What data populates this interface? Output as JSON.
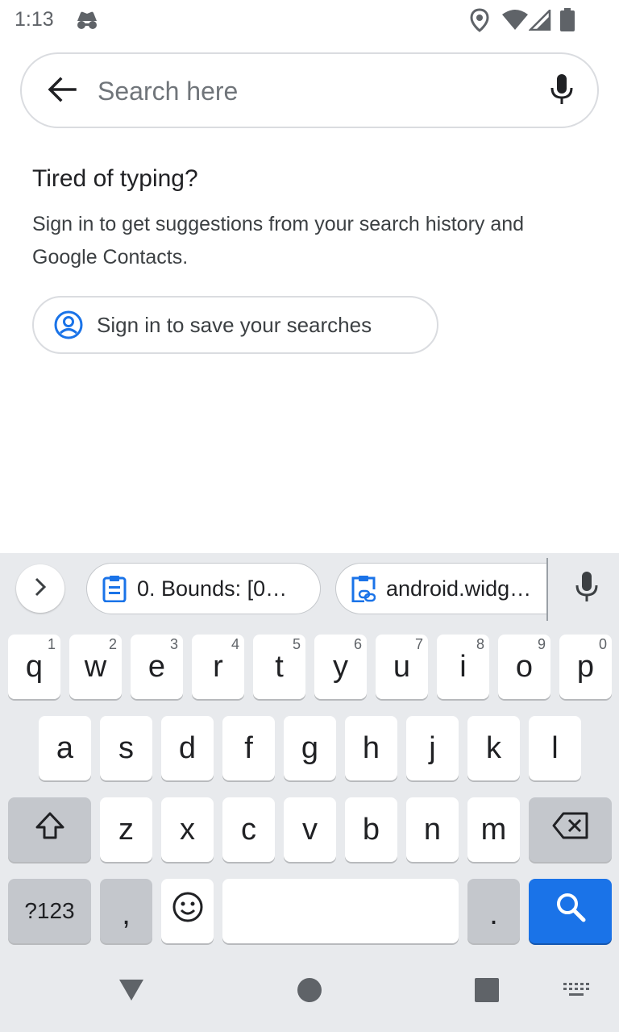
{
  "status_bar": {
    "time": "1:13",
    "icons": [
      "incognito-icon",
      "location-icon",
      "wifi-icon",
      "signal-icon",
      "battery-icon"
    ]
  },
  "search": {
    "placeholder": "Search here",
    "value": ""
  },
  "signin_prompt": {
    "title": "Tired of typing?",
    "body": "Sign in to get suggestions from your search history and Google Contacts.",
    "button_label": "Sign in to save your searches"
  },
  "keyboard": {
    "clipboard_chips": [
      {
        "text": "0. Bounds: [0…",
        "icon": "clipboard-icon"
      },
      {
        "text": "android.widg…",
        "icon": "clipboard-link-icon"
      }
    ],
    "row1": [
      {
        "key": "q",
        "hint": "1"
      },
      {
        "key": "w",
        "hint": "2"
      },
      {
        "key": "e",
        "hint": "3"
      },
      {
        "key": "r",
        "hint": "4"
      },
      {
        "key": "t",
        "hint": "5"
      },
      {
        "key": "y",
        "hint": "6"
      },
      {
        "key": "u",
        "hint": "7"
      },
      {
        "key": "i",
        "hint": "8"
      },
      {
        "key": "o",
        "hint": "9"
      },
      {
        "key": "p",
        "hint": "0"
      }
    ],
    "row2": [
      "a",
      "s",
      "d",
      "f",
      "g",
      "h",
      "j",
      "k",
      "l"
    ],
    "row3": [
      "z",
      "x",
      "c",
      "v",
      "b",
      "n",
      "m"
    ],
    "symbols_label": "?123",
    "comma_label": ",",
    "period_label": ".",
    "accent_color": "#1a73e8"
  },
  "nav_bar": {
    "icons": [
      "back-triangle-icon",
      "home-circle-icon",
      "recents-square-icon",
      "keyboard-switch-icon"
    ]
  }
}
